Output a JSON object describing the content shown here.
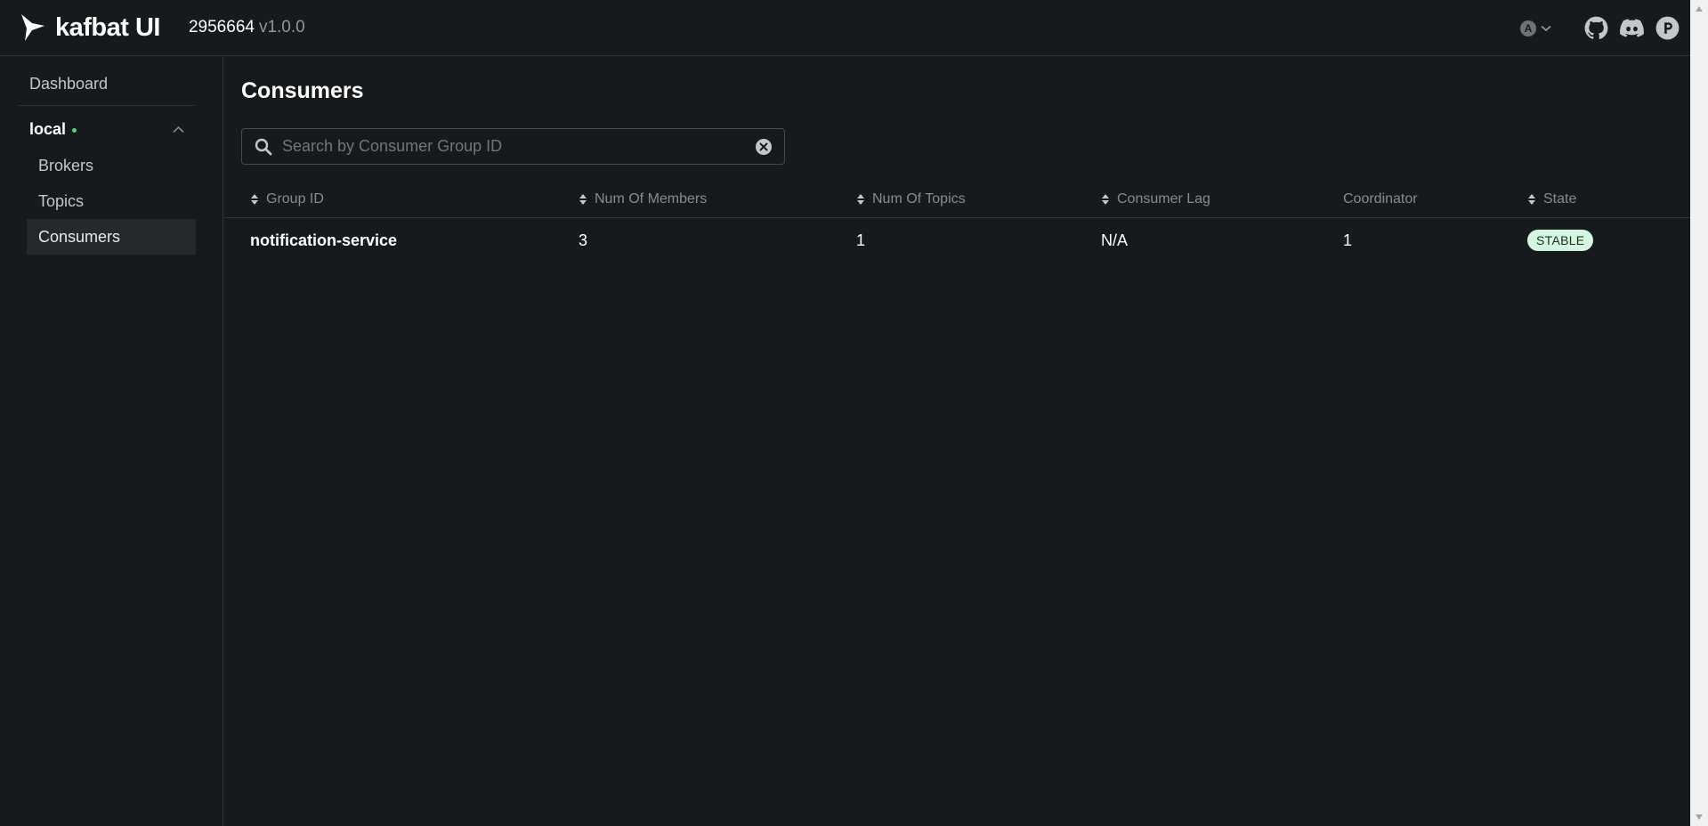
{
  "brand": {
    "name": "kafbat UI",
    "build": "2956664",
    "version": "v1.0.0",
    "logo_icon": "kafbat-logo-icon"
  },
  "header": {
    "theme_toggle": {
      "badge": "A",
      "icon": "chevron-down-icon"
    },
    "links": [
      {
        "name": "github-icon"
      },
      {
        "name": "discord-icon"
      },
      {
        "name": "product-hunt-icon"
      }
    ]
  },
  "sidebar": {
    "dashboard": "Dashboard",
    "cluster": {
      "name": "local",
      "status_color": "#5ccf8a"
    },
    "items": [
      {
        "label": "Brokers",
        "active": false
      },
      {
        "label": "Topics",
        "active": false
      },
      {
        "label": "Consumers",
        "active": true
      }
    ]
  },
  "main": {
    "title": "Consumers",
    "search": {
      "placeholder": "Search by Consumer Group ID",
      "value": ""
    },
    "table": {
      "columns": [
        "Group ID",
        "Num Of Members",
        "Num Of Topics",
        "Consumer Lag",
        "Coordinator",
        "State"
      ],
      "rows": [
        {
          "group_id": "notification-service",
          "members": "3",
          "topics": "1",
          "lag": "N/A",
          "coordinator": "1",
          "state": "STABLE"
        }
      ]
    }
  },
  "colors": {
    "background": "#171a1c",
    "border": "#2f3437",
    "badge_bg": "#d4f5df",
    "text_muted": "#848c91"
  }
}
